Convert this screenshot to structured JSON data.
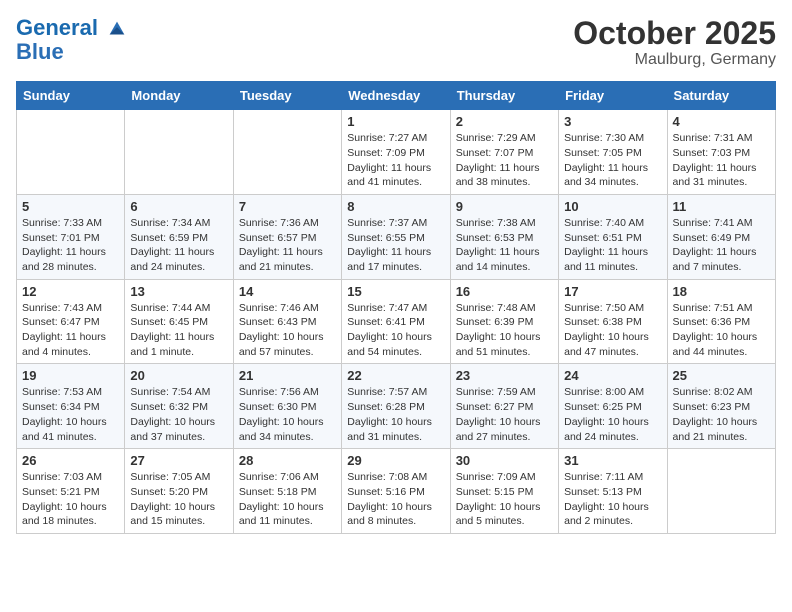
{
  "logo": {
    "line1": "General",
    "line2": "Blue"
  },
  "title": "October 2025",
  "subtitle": "Maulburg, Germany",
  "weekdays": [
    "Sunday",
    "Monday",
    "Tuesday",
    "Wednesday",
    "Thursday",
    "Friday",
    "Saturday"
  ],
  "weeks": [
    [
      {
        "day": "",
        "info": ""
      },
      {
        "day": "",
        "info": ""
      },
      {
        "day": "",
        "info": ""
      },
      {
        "day": "1",
        "info": "Sunrise: 7:27 AM\nSunset: 7:09 PM\nDaylight: 11 hours\nand 41 minutes."
      },
      {
        "day": "2",
        "info": "Sunrise: 7:29 AM\nSunset: 7:07 PM\nDaylight: 11 hours\nand 38 minutes."
      },
      {
        "day": "3",
        "info": "Sunrise: 7:30 AM\nSunset: 7:05 PM\nDaylight: 11 hours\nand 34 minutes."
      },
      {
        "day": "4",
        "info": "Sunrise: 7:31 AM\nSunset: 7:03 PM\nDaylight: 11 hours\nand 31 minutes."
      }
    ],
    [
      {
        "day": "5",
        "info": "Sunrise: 7:33 AM\nSunset: 7:01 PM\nDaylight: 11 hours\nand 28 minutes."
      },
      {
        "day": "6",
        "info": "Sunrise: 7:34 AM\nSunset: 6:59 PM\nDaylight: 11 hours\nand 24 minutes."
      },
      {
        "day": "7",
        "info": "Sunrise: 7:36 AM\nSunset: 6:57 PM\nDaylight: 11 hours\nand 21 minutes."
      },
      {
        "day": "8",
        "info": "Sunrise: 7:37 AM\nSunset: 6:55 PM\nDaylight: 11 hours\nand 17 minutes."
      },
      {
        "day": "9",
        "info": "Sunrise: 7:38 AM\nSunset: 6:53 PM\nDaylight: 11 hours\nand 14 minutes."
      },
      {
        "day": "10",
        "info": "Sunrise: 7:40 AM\nSunset: 6:51 PM\nDaylight: 11 hours\nand 11 minutes."
      },
      {
        "day": "11",
        "info": "Sunrise: 7:41 AM\nSunset: 6:49 PM\nDaylight: 11 hours\nand 7 minutes."
      }
    ],
    [
      {
        "day": "12",
        "info": "Sunrise: 7:43 AM\nSunset: 6:47 PM\nDaylight: 11 hours\nand 4 minutes."
      },
      {
        "day": "13",
        "info": "Sunrise: 7:44 AM\nSunset: 6:45 PM\nDaylight: 11 hours\nand 1 minute."
      },
      {
        "day": "14",
        "info": "Sunrise: 7:46 AM\nSunset: 6:43 PM\nDaylight: 10 hours\nand 57 minutes."
      },
      {
        "day": "15",
        "info": "Sunrise: 7:47 AM\nSunset: 6:41 PM\nDaylight: 10 hours\nand 54 minutes."
      },
      {
        "day": "16",
        "info": "Sunrise: 7:48 AM\nSunset: 6:39 PM\nDaylight: 10 hours\nand 51 minutes."
      },
      {
        "day": "17",
        "info": "Sunrise: 7:50 AM\nSunset: 6:38 PM\nDaylight: 10 hours\nand 47 minutes."
      },
      {
        "day": "18",
        "info": "Sunrise: 7:51 AM\nSunset: 6:36 PM\nDaylight: 10 hours\nand 44 minutes."
      }
    ],
    [
      {
        "day": "19",
        "info": "Sunrise: 7:53 AM\nSunset: 6:34 PM\nDaylight: 10 hours\nand 41 minutes."
      },
      {
        "day": "20",
        "info": "Sunrise: 7:54 AM\nSunset: 6:32 PM\nDaylight: 10 hours\nand 37 minutes."
      },
      {
        "day": "21",
        "info": "Sunrise: 7:56 AM\nSunset: 6:30 PM\nDaylight: 10 hours\nand 34 minutes."
      },
      {
        "day": "22",
        "info": "Sunrise: 7:57 AM\nSunset: 6:28 PM\nDaylight: 10 hours\nand 31 minutes."
      },
      {
        "day": "23",
        "info": "Sunrise: 7:59 AM\nSunset: 6:27 PM\nDaylight: 10 hours\nand 27 minutes."
      },
      {
        "day": "24",
        "info": "Sunrise: 8:00 AM\nSunset: 6:25 PM\nDaylight: 10 hours\nand 24 minutes."
      },
      {
        "day": "25",
        "info": "Sunrise: 8:02 AM\nSunset: 6:23 PM\nDaylight: 10 hours\nand 21 minutes."
      }
    ],
    [
      {
        "day": "26",
        "info": "Sunrise: 7:03 AM\nSunset: 5:21 PM\nDaylight: 10 hours\nand 18 minutes."
      },
      {
        "day": "27",
        "info": "Sunrise: 7:05 AM\nSunset: 5:20 PM\nDaylight: 10 hours\nand 15 minutes."
      },
      {
        "day": "28",
        "info": "Sunrise: 7:06 AM\nSunset: 5:18 PM\nDaylight: 10 hours\nand 11 minutes."
      },
      {
        "day": "29",
        "info": "Sunrise: 7:08 AM\nSunset: 5:16 PM\nDaylight: 10 hours\nand 8 minutes."
      },
      {
        "day": "30",
        "info": "Sunrise: 7:09 AM\nSunset: 5:15 PM\nDaylight: 10 hours\nand 5 minutes."
      },
      {
        "day": "31",
        "info": "Sunrise: 7:11 AM\nSunset: 5:13 PM\nDaylight: 10 hours\nand 2 minutes."
      },
      {
        "day": "",
        "info": ""
      }
    ]
  ]
}
